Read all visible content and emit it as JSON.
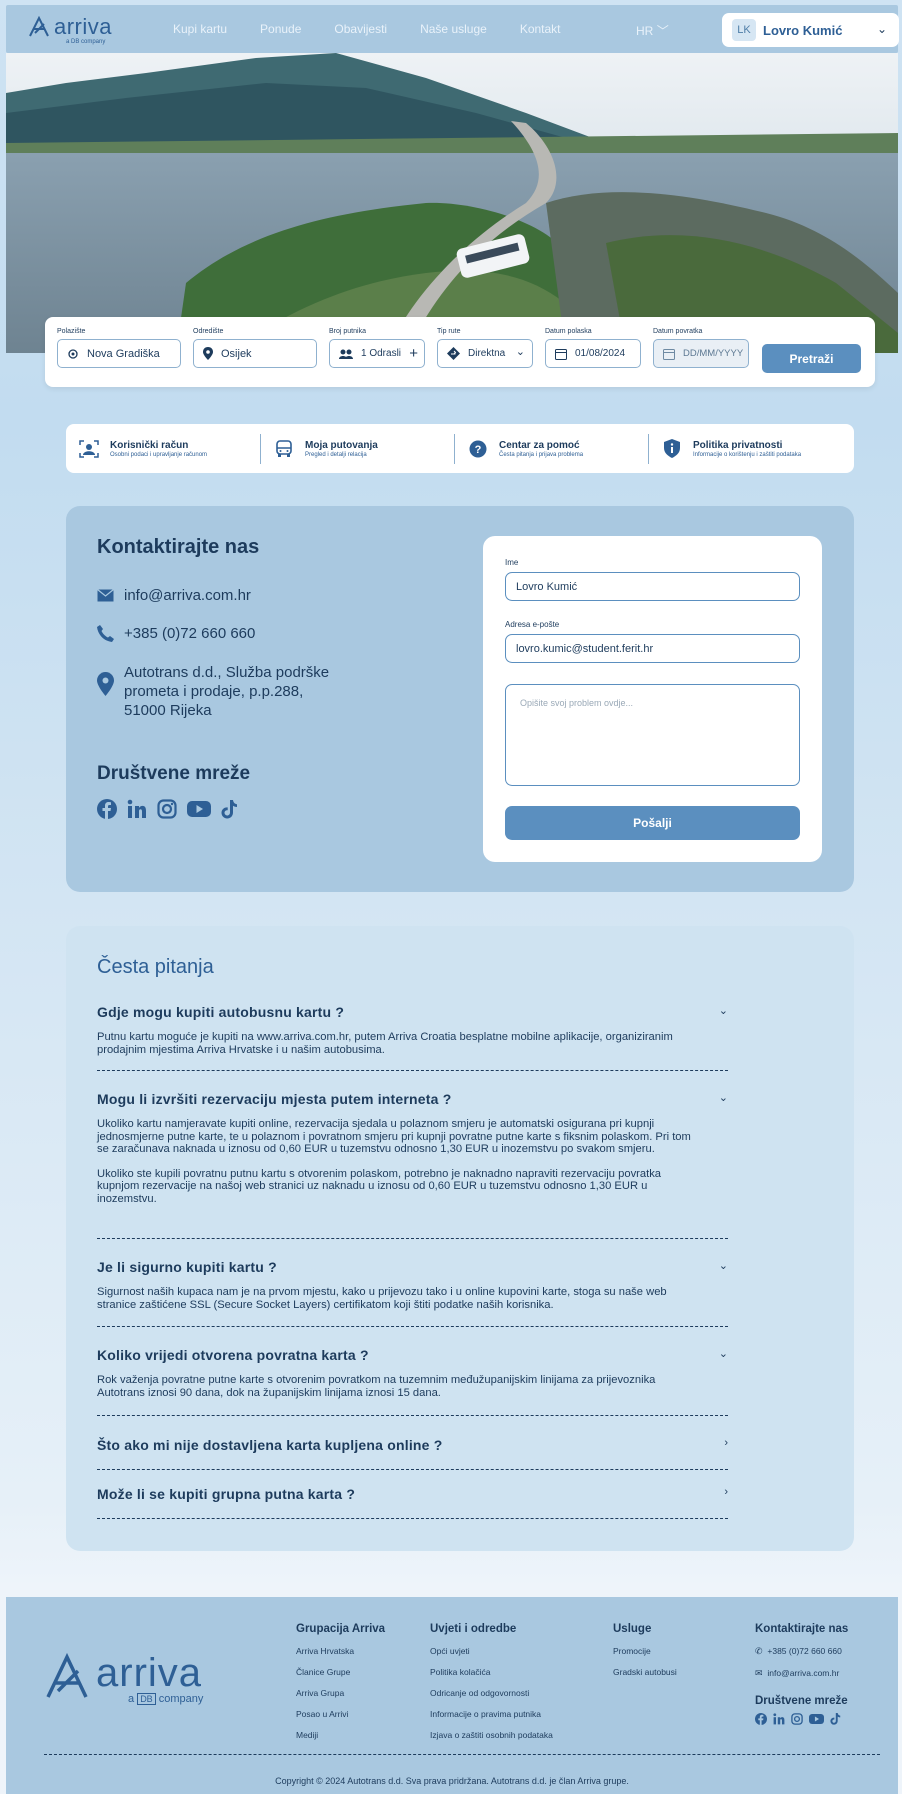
{
  "header": {
    "logo_text": "arriva",
    "logo_sub": "a DB company",
    "nav": [
      "Kupi kartu",
      "Ponude",
      "Obavijesti",
      "Naše usluge",
      "Kontakt"
    ],
    "lang": "HR",
    "user_initials": "LK",
    "user_name": "Lovro Kumić"
  },
  "search": {
    "from_label": "Polazište",
    "from_value": "Nova Gradiška",
    "to_label": "Odredište",
    "to_value": "Osijek",
    "pass_label": "Broj putnika",
    "pass_value": "1 Odrasli",
    "route_label": "Tip rute",
    "route_value": "Direktna",
    "dep_label": "Datum polaska",
    "dep_value": "01/08/2024",
    "ret_label": "Datum povratka",
    "ret_placeholder": "DD/MM/YYYY",
    "button": "Pretraži"
  },
  "quick_links": [
    {
      "title": "Korisnički račun",
      "sub": "Osobni podaci i upravljanje računom"
    },
    {
      "title": "Moja putovanja",
      "sub": "Pregled i detalji relacija"
    },
    {
      "title": "Centar za pomoć",
      "sub": "Česta pitanja i prijava problema"
    },
    {
      "title": "Politika privatnosti",
      "sub": "Informacije o korištenju i zaštiti podataka"
    }
  ],
  "contact": {
    "title": "Kontaktirajte nas",
    "email": "info@arriva.com.hr",
    "phone": "+385 (0)72 660 660",
    "address_1": "Autotrans d.d., Služba podrške",
    "address_2": "prometa i prodaje, p.p.288,",
    "address_3": "51000 Rijeka",
    "social_title": "Društvene mreže",
    "form": {
      "name_label": "Ime",
      "name_value": "Lovro Kumić",
      "email_label": "Adresa e-pošte",
      "email_value": "lovro.kumic@student.ferit.hr",
      "message_placeholder": "Opišite svoj problem ovdje...",
      "send": "Pošalji"
    }
  },
  "faq": {
    "title": "Česta pitanja",
    "items": [
      {
        "q": "Gdje mogu kupiti autobusnu kartu ?",
        "a1": "Putnu kartu moguće je kupiti na www.arriva.com.hr, putem Arriva Croatia besplatne mobilne aplikacije, organiziranim prodajnim mjestima Arriva Hrvatske i u našim autobusima."
      },
      {
        "q": "Mogu li izvršiti rezervaciju mjesta putem interneta ?",
        "a1": "Ukoliko kartu namjeravate kupiti online, rezervacija sjedala u polaznom smjeru je automatski osigurana pri kupnji jednosmjerne putne karte, te u polaznom i povratnom smjeru pri kupnji povratne putne karte s fiksnim polaskom. Pri tom se zaračunava naknada u iznosu od 0,60 EUR u tuzemstvu odnosno 1,30 EUR u inozemstvu po svakom smjeru.",
        "a2": "Ukoliko ste kupili povratnu putnu kartu s otvorenim polaskom, potrebno je naknadno napraviti rezervaciju povratka kupnjom rezervacije na našoj web stranici uz naknadu u iznosu od 0,60 EUR u tuzemstvu odnosno 1,30 EUR u inozemstvu."
      },
      {
        "q": "Je li sigurno kupiti kartu ?",
        "a1": "Sigurnost naših kupaca nam je na prvom mjestu, kako u prijevozu tako i u online kupovini karte, stoga su naše web stranice zaštićene SSL (Secure Socket Layers) certifikatom koji štiti podatke naših korisnika."
      },
      {
        "q": "Koliko vrijedi otvorena povratna karta ?",
        "a1": "Rok važenja povratne putne karte s otvorenim povratkom na tuzemnim međužupanijskim linijama za prijevoznika Autotrans iznosi 90 dana, dok na županijskim linijama iznosi 15 dana."
      },
      {
        "q": "Što ako mi nije dostavljena karta kupljena online ?"
      },
      {
        "q": "Može li se kupiti grupna putna karta ?"
      }
    ]
  },
  "footer": {
    "logo_text": "arriva",
    "logo_sub_a": "a",
    "logo_sub_db": "DB",
    "logo_sub_company": "company",
    "col1_title": "Grupacija Arriva",
    "col1": [
      "Arriva Hrvatska",
      "Članice Grupe",
      "Arriva Grupa",
      "Posao u Arrivi",
      "Mediji"
    ],
    "col2_title": "Uvjeti i odredbe",
    "col2": [
      "Opći uvjeti",
      "Politika kolačića",
      "Odricanje od odgovornosti",
      "Informacije o pravima putnika",
      "Izjava o zaštiti osobnih podataka"
    ],
    "col3_title": "Usluge",
    "col3": [
      "Promocije",
      "Gradski autobusi"
    ],
    "col4_title": "Kontaktirajte nas",
    "phone": "+385 (0)72 660 660",
    "email": "info@arriva.com.hr",
    "social_title": "Društvene mreže",
    "copyright": "Copyright © 2024 Autotrans d.d. Sva prava pridržana. Autotrans d.d. je član Arriva grupe."
  },
  "colors": {
    "accent": "#5b8fbf",
    "navy": "#1d3b5c",
    "panel": "#a9c8e0"
  }
}
